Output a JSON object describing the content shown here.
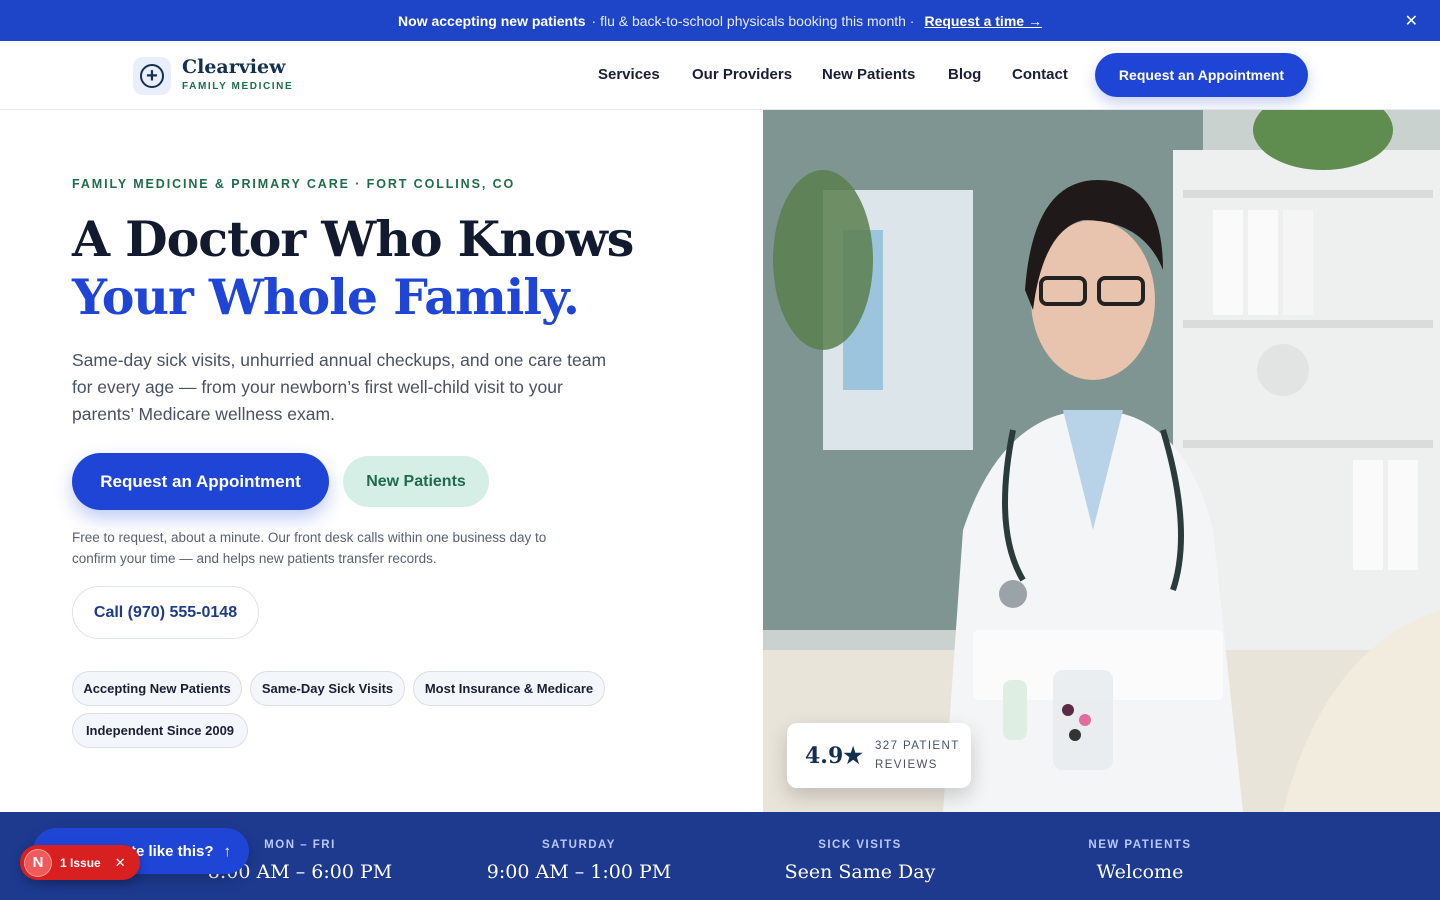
{
  "announcement": {
    "bold": "Now accepting new patients",
    "text": "· flu & back-to-school physicals booking this month ·",
    "link": "Request a time →",
    "close_icon": "close-icon"
  },
  "header": {
    "brand_name": "Clearview",
    "brand_sub": "FAMILY MEDICINE",
    "logo_icon": "plus-circle-icon",
    "nav": [
      "Services",
      "Our Providers",
      "New Patients",
      "Blog",
      "Contact"
    ],
    "cta": "Request an Appointment"
  },
  "hero": {
    "eyebrow": "FAMILY MEDICINE & PRIMARY CARE · FORT COLLINS, CO",
    "title_line1": "A Doctor Who Knows",
    "title_line2": "Your Whole Family.",
    "lede": "Same-day sick visits, unhurried annual checkups, and one care team for every age — from your newborn’s first well-child visit to your parents’ Medicare wellness exam.",
    "primary_cta": "Request an Appointment",
    "secondary_cta": "New Patients",
    "fineprint": "Free to request, about a minute. Our front desk calls within one business day to confirm your time — and helps new patients transfer records.",
    "call_cta": "Call (970) 555-0148",
    "chips": [
      "Accepting New Patients",
      "Same-Day Sick Visits",
      "Most Insurance & Medicare",
      "Independent Since 2009"
    ]
  },
  "rating": {
    "score": "4.9★",
    "label": "327 PATIENT REVIEWS"
  },
  "hours": [
    {
      "label": "MON – FRI",
      "value": "8:00 AM – 6:00 PM"
    },
    {
      "label": "SATURDAY",
      "value": "9:00 AM – 1:00 PM"
    },
    {
      "label": "SICK VISITS",
      "value": "Seen Same Day"
    },
    {
      "label": "NEW PATIENTS",
      "value": "Welcome"
    }
  ],
  "widgets": {
    "pill_text": "te like this?",
    "pill_icon": "arrow-up-icon",
    "issue_letter": "N",
    "issue_text": "1 Issue",
    "issue_close_icon": "close-icon"
  },
  "colors": {
    "brand_blue": "#1e45d6",
    "navy": "#13304f",
    "green": "#1f6b4d",
    "hours_bg": "#1e3a8f"
  }
}
